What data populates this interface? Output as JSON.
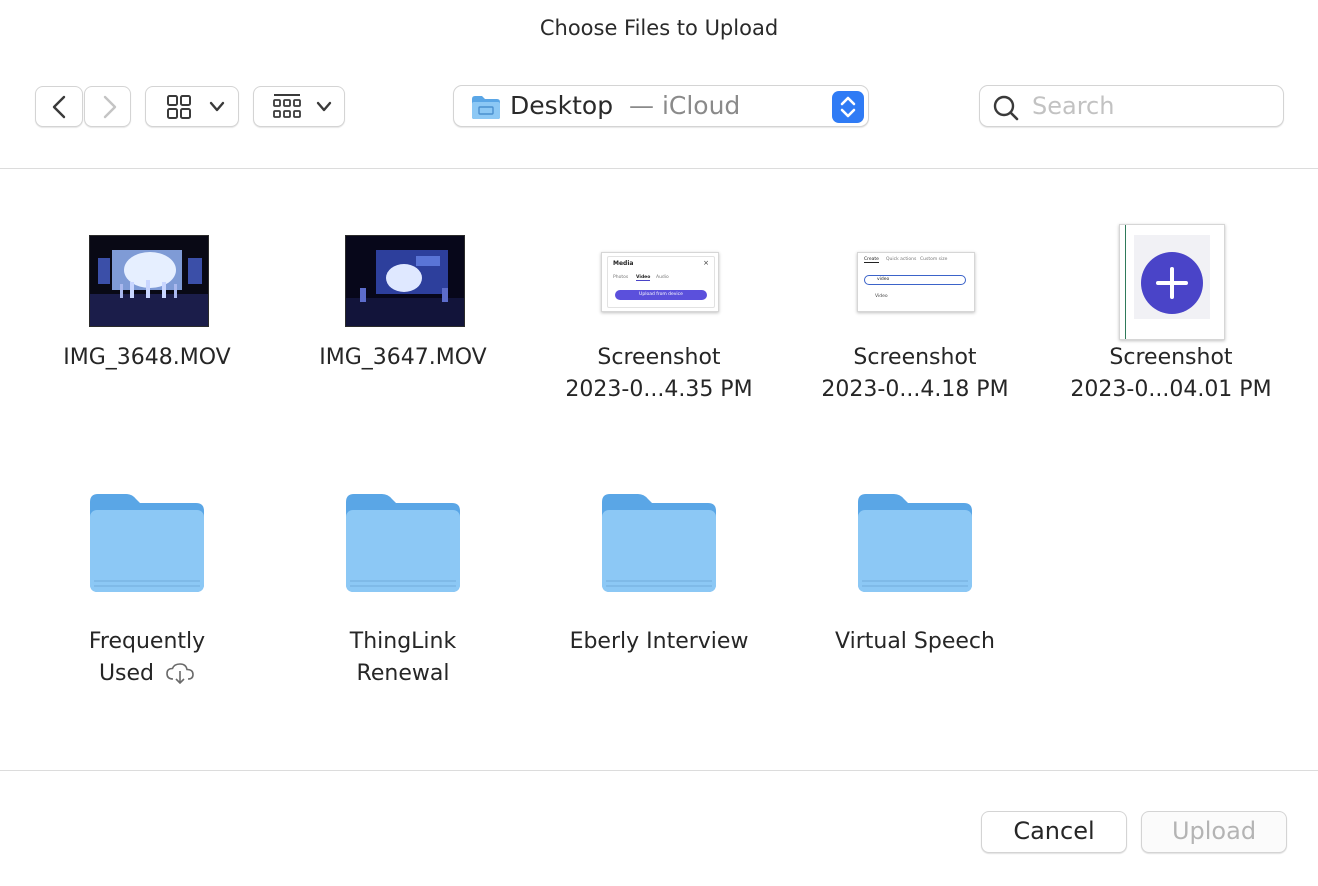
{
  "dialog": {
    "title": "Choose Files to Upload"
  },
  "toolbar": {
    "back_icon": "chevron-left-icon",
    "forward_icon": "chevron-right-icon",
    "view_icon": "icon-grid-icon",
    "group_icon": "group-grid-icon",
    "location_name": "Desktop",
    "location_suffix": "— iCloud",
    "location_accent": "#2f7bf5",
    "search_placeholder": "Search"
  },
  "files": [
    {
      "label_line1": "IMG_3648.MOV",
      "label_line2": "",
      "kind": "video"
    },
    {
      "label_line1": "IMG_3647.MOV",
      "label_line2": "",
      "kind": "video"
    },
    {
      "label_line1": "Screenshot",
      "label_line2": "2023-0...4.35 PM",
      "kind": "screenshot"
    },
    {
      "label_line1": "Screenshot",
      "label_line2": "2023-0...4.18 PM",
      "kind": "screenshot"
    },
    {
      "label_line1": "Screenshot",
      "label_line2": "2023-0...04.01 PM",
      "kind": "screenshot"
    }
  ],
  "folders": [
    {
      "label_line1": "Frequently",
      "label_line2": "Used",
      "cloud": true
    },
    {
      "label_line1": "ThingLink",
      "label_line2": "Renewal",
      "cloud": false
    },
    {
      "label_line1": "Eberly Interview",
      "label_line2": "",
      "cloud": false
    },
    {
      "label_line1": "Virtual Speech",
      "label_line2": "",
      "cloud": false
    }
  ],
  "thumbs": {
    "media_title": "Media",
    "media_tabs": [
      "Photos",
      "Video",
      "Audio"
    ],
    "media_button": "Upload from device",
    "create_tabs": [
      "Create",
      "Quick actions",
      "Custom size"
    ],
    "create_search": "video",
    "create_result": "Video",
    "plus_color": "#4a44c8"
  },
  "folder_colors": {
    "front": "#8cc8f5",
    "back": "#5aa6e6"
  },
  "footer": {
    "cancel_label": "Cancel",
    "upload_label": "Upload"
  }
}
